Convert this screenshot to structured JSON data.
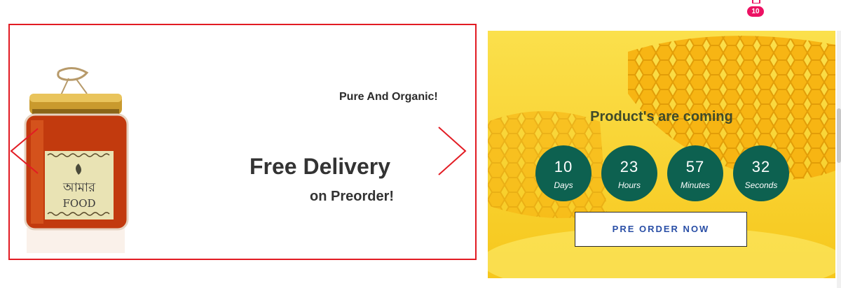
{
  "header": {
    "cart_count": "10"
  },
  "slider": {
    "tagline": "Pure And Organic!",
    "headline": "Free Delivery",
    "subline": "on Preorder!",
    "product": {
      "label_line1": "আমার",
      "label_line2": "FOOD"
    },
    "accent_color": "#e21b23"
  },
  "countdown": {
    "title": "Product's are coming",
    "units": [
      {
        "value": "10",
        "label": "Days"
      },
      {
        "value": "23",
        "label": "Hours"
      },
      {
        "value": "57",
        "label": "Minutes"
      },
      {
        "value": "32",
        "label": "Seconds"
      }
    ],
    "button_label": "PRE ORDER NOW",
    "circle_color": "#0d6150"
  }
}
